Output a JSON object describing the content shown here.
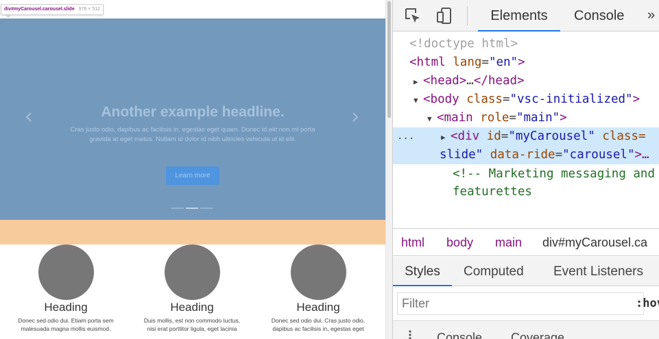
{
  "page": {
    "tooltip": {
      "element": "div#myCarousel.carousel.slide",
      "dims": "976 × 512"
    },
    "carousel": {
      "prev_icon": "chevron-left-icon",
      "next_icon": "chevron-right-icon",
      "headline": "Another example headline.",
      "caption": "Cras justo odio, dapibus ac facilisis in, egestas eget quam. Donec id elit non mi porta gravida at eget metus. Nullam id dolor id nibh ultricies vehicula ut id elit.",
      "button": "Learn more",
      "colors": {
        "background": "#7399bd",
        "padding_overlay": "#f8cb9b",
        "button": "#4f94de"
      }
    },
    "features": [
      {
        "heading": "Heading",
        "text": "Donec sed odio dui. Etiam porta sem malesuada magna mollis euismod."
      },
      {
        "heading": "Heading",
        "text": "Duis mollis, est non commodo luctus, nisi erat porttitor ligula, eget lacinia"
      },
      {
        "heading": "Heading",
        "text": "Donec sed odio dui. Cras justo odio, dapibus ac facilisis in, egestas eget"
      }
    ]
  },
  "devtools": {
    "toolbar": {
      "inspect_icon": "inspect-cursor-icon",
      "device_icon": "device-toggle-icon",
      "more": "»"
    },
    "tabs": [
      "Elements",
      "Console"
    ],
    "dom": {
      "doctype": "<!doctype html>",
      "html_tag": "html",
      "html_attr": "lang",
      "html_val": "\"en\"",
      "head_tag": "head",
      "head_ellipsis": "…",
      "body_tag": "body",
      "body_attr": "class",
      "body_val": "\"vsc-initialized\"",
      "main_tag": "main",
      "main_attr": "role",
      "main_val": "\"main\"",
      "div_tag": "div",
      "div_id_attr": "id",
      "div_id_val": "\"myCarousel\"",
      "div_class_attr": "class=",
      "div_line2_val": "slide\"",
      "div_ride_attr": "data-ride",
      "div_ride_val": "\"carousel\"",
      "comment_1": "<!-- Marketing messaging and",
      "comment_2": "featurettes",
      "dots": "..."
    },
    "breadcrumbs": [
      "html",
      "body",
      "main",
      "div#myCarousel.ca"
    ],
    "subtabs": [
      "Styles",
      "Computed",
      "Event Listeners"
    ],
    "filter": {
      "placeholder": "Filter",
      "hov": ":hov"
    },
    "drawer": {
      "more_icon": "kebab-menu-icon",
      "tabs": [
        "Console",
        "Coverage"
      ]
    },
    "colors": {
      "accent": "#1a73e8",
      "selected_row": "#cfe8fc",
      "tag": "#881280",
      "attr": "#994500",
      "value": "#1a1aa6",
      "comment": "#236e25"
    }
  }
}
